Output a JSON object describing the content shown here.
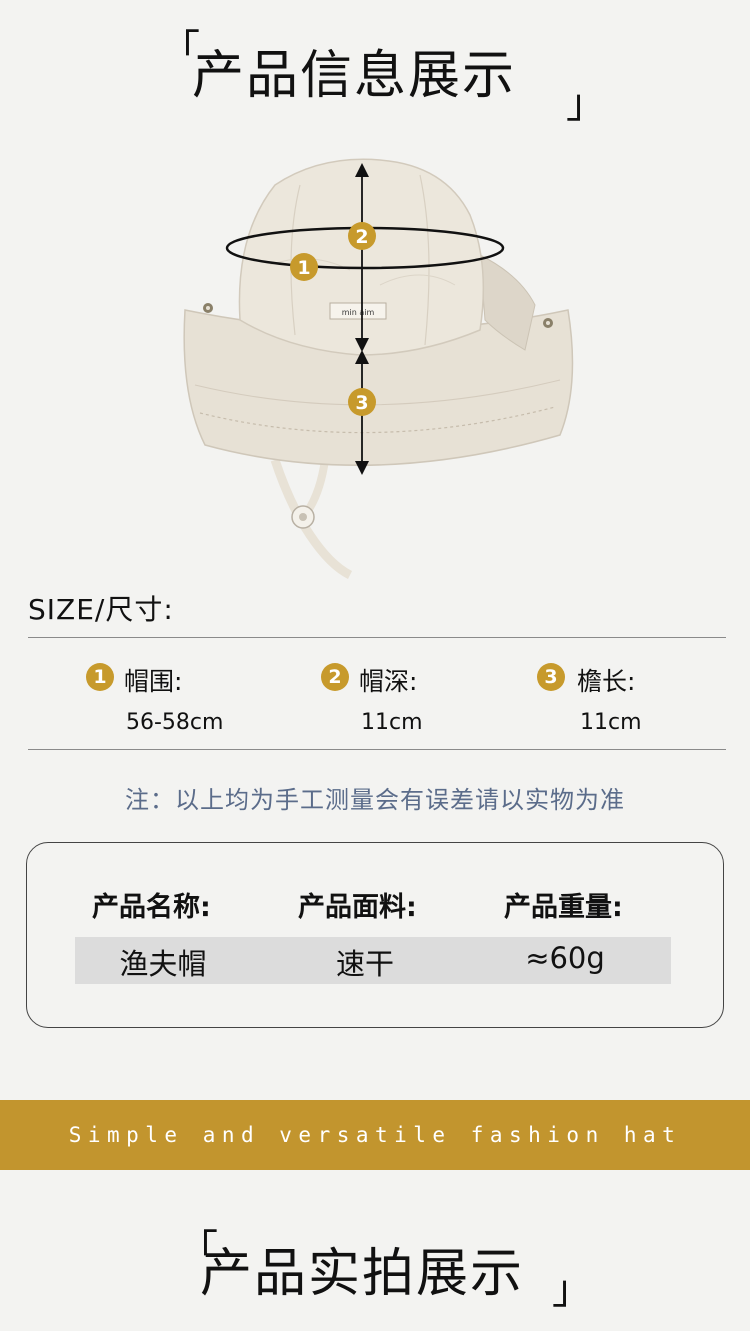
{
  "header": {
    "bracket_open": "「",
    "title": "产品信息展示",
    "bracket_close": "」"
  },
  "hat_label": "min aim",
  "markers": [
    "1",
    "2",
    "3"
  ],
  "size": {
    "title": "SIZE/尺寸:",
    "items": [
      {
        "num": "1",
        "label": "帽围:",
        "value": "56-58cm"
      },
      {
        "num": "2",
        "label": "帽深:",
        "value": "11cm"
      },
      {
        "num": "3",
        "label": "檐长:",
        "value": "11cm"
      }
    ]
  },
  "note": "注：以上均为手工测量会有误差请以实物为准",
  "info": {
    "headers": [
      "产品名称:",
      "产品面料:",
      "产品重量:"
    ],
    "values": [
      "渔夫帽",
      "速干",
      "≈60g"
    ]
  },
  "banner": "Simple and versatile fashion hat",
  "footer": {
    "bracket_open": "「",
    "title": "产品实拍展示",
    "bracket_close": "」"
  },
  "colors": {
    "accent": "#c2952e",
    "marker": "#c79a2c",
    "note": "#5b6c8a",
    "hat": "#e6e0d4"
  }
}
